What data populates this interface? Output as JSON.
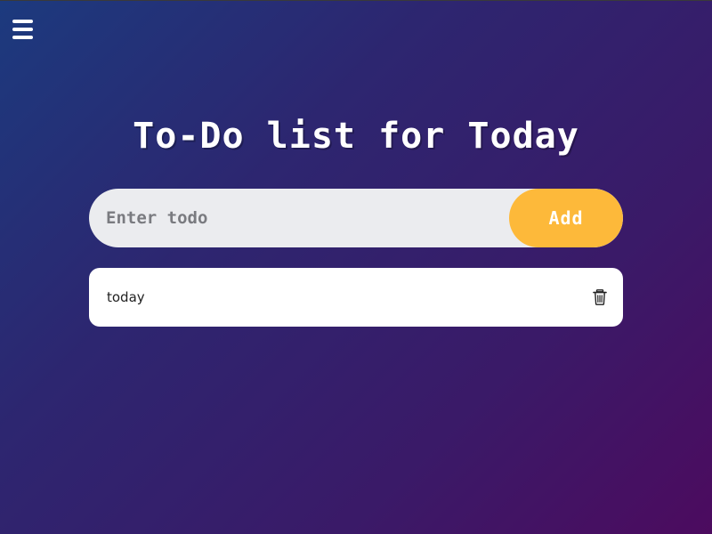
{
  "header": {
    "menu_icon": "hamburger-menu-icon"
  },
  "title": "To-Do list for Today",
  "form": {
    "input_placeholder": "Enter todo",
    "input_value": "",
    "add_label": "Add"
  },
  "todos": [
    {
      "text": "today",
      "delete_icon": "trash-icon"
    }
  ],
  "colors": {
    "background_start": "#1c3a7e",
    "background_end": "#4c0b5f",
    "accent": "#fdb93a",
    "input_bg": "#ebecef",
    "card_bg": "#ffffff"
  }
}
